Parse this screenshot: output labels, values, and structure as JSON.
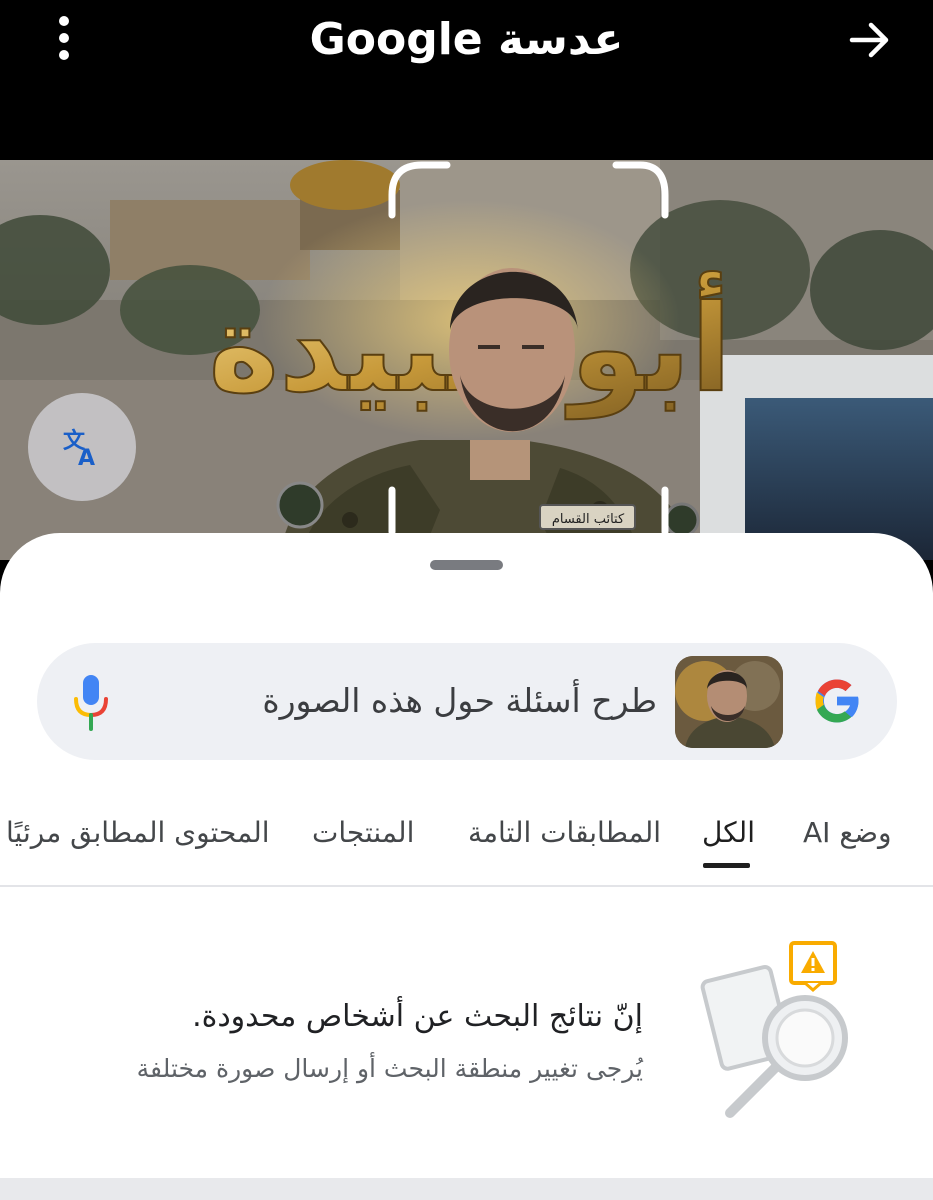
{
  "topbar": {
    "title": "عدسة Google",
    "menu_icon": "more-vertical-icon",
    "forward_icon": "arrow-right-icon"
  },
  "photo": {
    "overlay_text": "أبو عبيدة",
    "badge_text": "كتائب القسام",
    "translate_icon": "translate-icon"
  },
  "search": {
    "placeholder": "طرح أسئلة حول هذه الصورة",
    "logo_icon": "google-g-icon",
    "mic_icon": "microphone-icon"
  },
  "tabs": [
    {
      "label": "وضع AI"
    },
    {
      "label": "الكل"
    },
    {
      "label": "المطابقات التامة"
    },
    {
      "label": "المنتجات"
    },
    {
      "label": "المحتوى المطابق مرئيًا"
    }
  ],
  "active_tab": "الكل",
  "message": {
    "title": "إنّ نتائج البحث عن أشخاص محدودة.",
    "subtitle": "يُرجى تغيير منطقة البحث أو إرسال صورة مختلفة"
  },
  "colors": {
    "google_blue": "#4285F4",
    "google_red": "#EA4335",
    "google_yellow": "#FBBC05",
    "google_green": "#34A853",
    "warning": "#F9AB00"
  }
}
